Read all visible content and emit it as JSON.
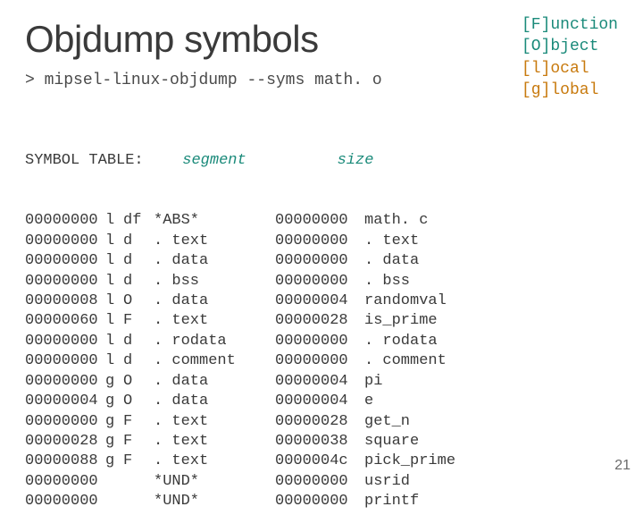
{
  "title": "Objdump symbols",
  "command": {
    "prompt": ">",
    "text": "mipsel-linux-objdump --syms math. o"
  },
  "legend": [
    {
      "bracketed": "F",
      "rest": "unction",
      "colorClass": "teal"
    },
    {
      "bracketed": "O",
      "rest": "bject",
      "colorClass": "teal"
    },
    {
      "bracketed": "l",
      "rest": "ocal",
      "colorClass": "orange"
    },
    {
      "bracketed": "g",
      "rest": "lobal",
      "colorClass": "orange"
    }
  ],
  "headers": {
    "symbolTable": "SYMBOL TABLE:",
    "segment": "segment",
    "size": "size"
  },
  "rows": [
    {
      "addr": "00000000",
      "scope": "l",
      "type": "df",
      "segment": "*ABS*",
      "size": "00000000",
      "name": "math. c"
    },
    {
      "addr": "00000000",
      "scope": "l",
      "type": "d",
      "segment": ". text",
      "size": "00000000",
      "name": ". text"
    },
    {
      "addr": "00000000",
      "scope": "l",
      "type": "d",
      "segment": ". data",
      "size": "00000000",
      "name": ". data"
    },
    {
      "addr": "00000000",
      "scope": "l",
      "type": "d",
      "segment": ". bss",
      "size": "00000000",
      "name": ". bss"
    },
    {
      "addr": "00000008",
      "scope": "l",
      "type": "O",
      "segment": ". data",
      "size": "00000004",
      "name": "randomval"
    },
    {
      "addr": "00000060",
      "scope": "l",
      "type": "F",
      "segment": ". text",
      "size": "00000028",
      "name": "is_prime"
    },
    {
      "addr": "00000000",
      "scope": "l",
      "type": "d",
      "segment": ". rodata",
      "size": "00000000",
      "name": ". rodata"
    },
    {
      "addr": "00000000",
      "scope": "l",
      "type": "d",
      "segment": ". comment",
      "size": "00000000",
      "name": ". comment"
    },
    {
      "addr": "00000000",
      "scope": "g",
      "type": "O",
      "segment": ". data",
      "size": "00000004",
      "name": "pi"
    },
    {
      "addr": "00000004",
      "scope": "g",
      "type": "O",
      "segment": ". data",
      "size": "00000004",
      "name": "e"
    },
    {
      "addr": "00000000",
      "scope": "g",
      "type": "F",
      "segment": ". text",
      "size": "00000028",
      "name": "get_n"
    },
    {
      "addr": "00000028",
      "scope": "g",
      "type": "F",
      "segment": ". text",
      "size": "00000038",
      "name": "square"
    },
    {
      "addr": "00000088",
      "scope": "g",
      "type": "F",
      "segment": ". text",
      "size": "0000004c",
      "name": "pick_prime"
    },
    {
      "addr": "00000000",
      "scope": "",
      "type": "",
      "segment": "*UND*",
      "size": "00000000",
      "name": "usrid"
    },
    {
      "addr": "00000000",
      "scope": "",
      "type": "",
      "segment": "*UND*",
      "size": "00000000",
      "name": "printf"
    }
  ],
  "pageNumber": "21"
}
